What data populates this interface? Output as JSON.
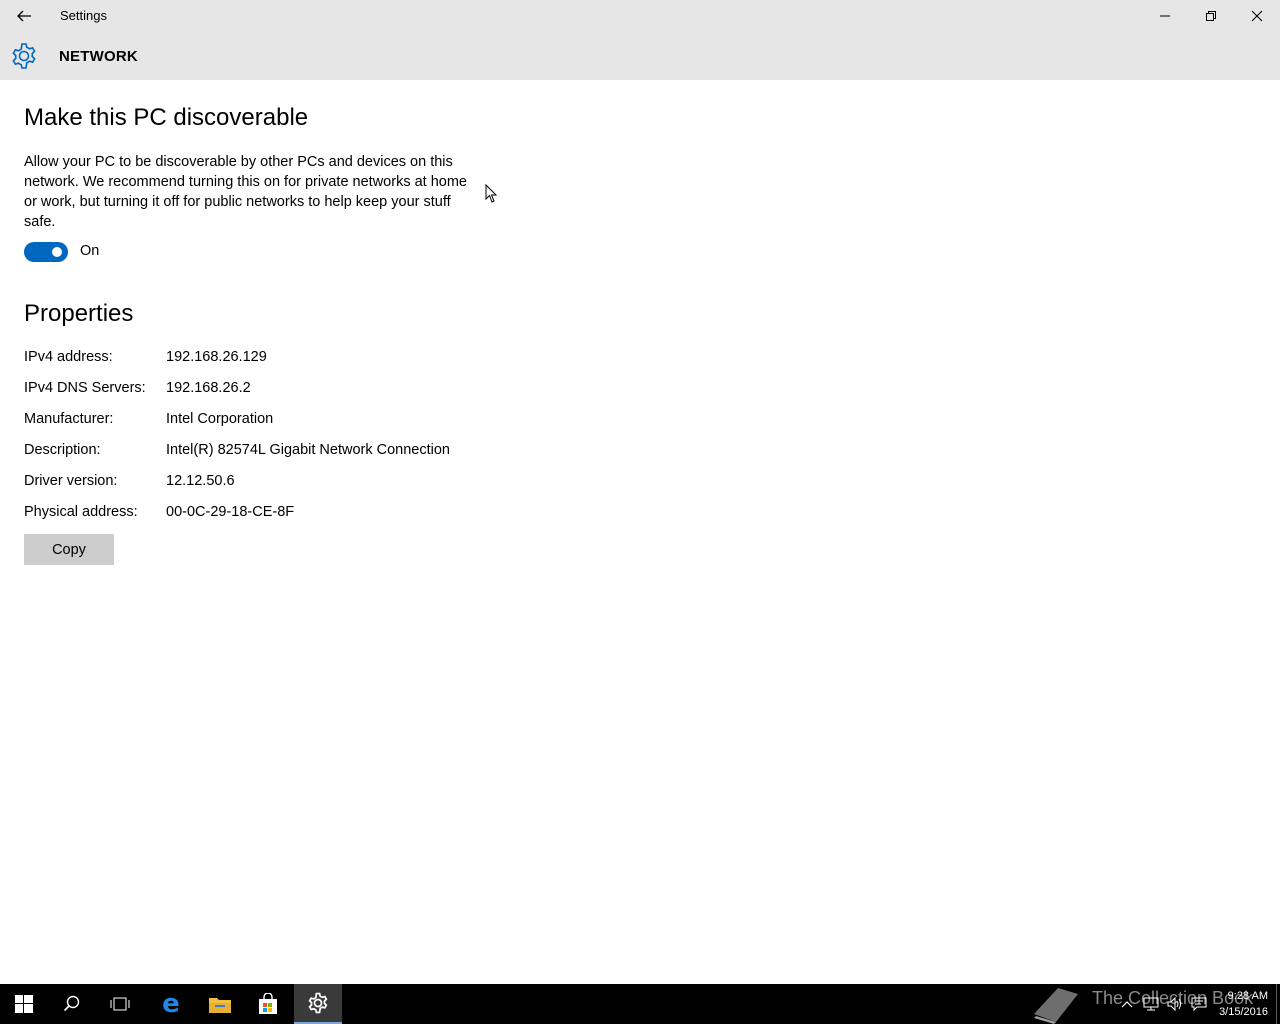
{
  "window": {
    "title": "Settings"
  },
  "header": {
    "title": "NETWORK"
  },
  "discoverable": {
    "heading": "Make this PC discoverable",
    "description": "Allow your PC to be discoverable by other PCs and devices on this network. We recommend turning this on for private networks at home or work, but turning it off for public networks to help keep your stuff safe.",
    "toggle_state": "On"
  },
  "properties": {
    "heading": "Properties",
    "rows": [
      {
        "key": "IPv4 address:",
        "value": "192.168.26.129"
      },
      {
        "key": "IPv4 DNS Servers:",
        "value": "192.168.26.2"
      },
      {
        "key": "Manufacturer:",
        "value": "Intel Corporation"
      },
      {
        "key": "Description:",
        "value": "Intel(R) 82574L Gigabit Network Connection"
      },
      {
        "key": "Driver version:",
        "value": "12.12.50.6"
      },
      {
        "key": "Physical address:",
        "value": "00-0C-29-18-CE-8F"
      }
    ],
    "copy_label": "Copy"
  },
  "taskbar": {
    "clock_time": "9:28 AM",
    "clock_date": "3/15/2016",
    "watermark": "The Collection Book"
  },
  "colors": {
    "accent": "#0067c0",
    "chrome": "#e6e6e6",
    "taskbar": "#000000"
  }
}
